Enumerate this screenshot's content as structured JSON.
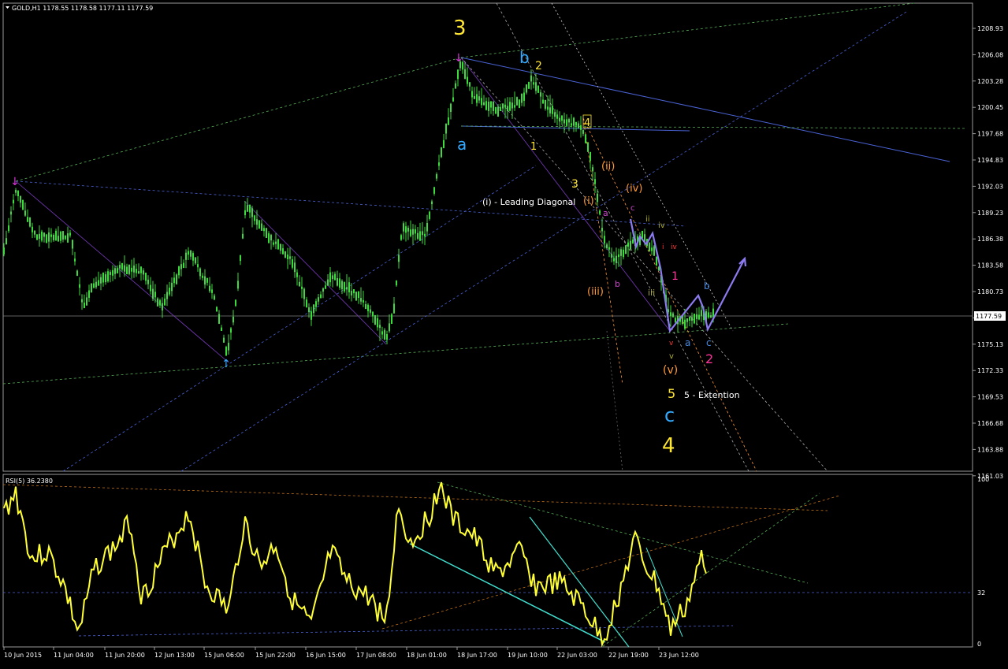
{
  "main_chart": {
    "header": "GOLD,H1  1178.55 1178.58 1177.11 1177.59",
    "price_ticks": [
      "1208.93",
      "1206.08",
      "1203.28",
      "1200.45",
      "1197.68",
      "1194.83",
      "1192.03",
      "1189.23",
      "1186.38",
      "1183.58",
      "1180.73",
      "1177.93",
      "1175.13",
      "1172.33",
      "1169.53",
      "1166.68",
      "1163.88",
      "1161.03"
    ],
    "current_price": "1177.59",
    "labels": {
      "wave3_big": "3",
      "wave4_big": "4",
      "b_blue": "b",
      "two_yellow": "2",
      "a_blue": "a",
      "one_yellow": "1",
      "four_small": "4",
      "three_yellow": "3",
      "ii_orange": "(ii)",
      "iv_orange": "(iv)",
      "i_orange": "(i)",
      "leading_diagonal": "(i) - Leading Diagonal",
      "a_magenta": "a",
      "c_magenta": "c",
      "b_magenta": "b",
      "iii_orange": "(iii)",
      "ii_small": "ii",
      "iv_small": "iv",
      "i_small": "i",
      "iv_red": "iv",
      "one_magenta": "1",
      "iii_small": "iii",
      "b_small_blue": "b",
      "v_red": "v",
      "a_small_blue": "a",
      "c_small_blue": "c",
      "v_small": "v",
      "two_pink": "2",
      "v_orange": "(v)",
      "five_yellow": "5",
      "extension": "5 - Extention",
      "c_big_blue": "c"
    }
  },
  "rsi_chart": {
    "header": "RSI(5) 36.2380",
    "ticks": [
      "100",
      "32",
      "0"
    ]
  },
  "time_axis": {
    "labels": [
      "10 Jun 2015",
      "11 Jun 04:00",
      "11 Jun 20:00",
      "12 Jun 13:00",
      "15 Jun 06:00",
      "15 Jun 22:00",
      "16 Jun 15:00",
      "17 Jun 08:00",
      "18 Jun 01:00",
      "18 Jun 17:00",
      "19 Jun 10:00",
      "22 Jun 03:00",
      "22 Jun 19:00",
      "23 Jun 12:00"
    ]
  },
  "colors": {
    "background": "#000000",
    "candle": "#3ddc3d",
    "rsi_line": "#ffff33",
    "cyan": "#40e0d0",
    "blue_line": "#4a63d6",
    "yellow": "#ffe633",
    "orange": "#ff9933",
    "magenta": "#cc44cc",
    "pink": "#ff3399",
    "lightblue": "#33aaff",
    "arrow": "#8c7bf0"
  }
}
